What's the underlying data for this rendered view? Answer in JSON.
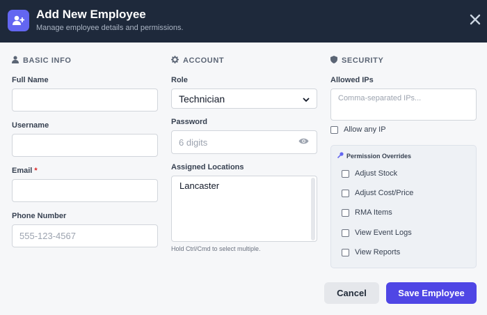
{
  "header": {
    "title": "Add New Employee",
    "subtitle": "Manage employee details and permissions."
  },
  "basic_info": {
    "section_title": "BASIC INFO",
    "full_name_label": "Full Name",
    "full_name_value": "",
    "username_label": "Username",
    "username_value": "",
    "email_label": "Email",
    "email_required": "*",
    "email_value": "",
    "phone_label": "Phone Number",
    "phone_placeholder": "555-123-4567",
    "phone_value": ""
  },
  "account": {
    "section_title": "ACCOUNT",
    "role_label": "Role",
    "role_value": "Technician",
    "password_label": "Password",
    "password_placeholder": "6 digits",
    "locations_label": "Assigned Locations",
    "locations": [
      "Lancaster"
    ],
    "locations_hint": "Hold Ctrl/Cmd to select multiple."
  },
  "security": {
    "section_title": "SECURITY",
    "allowed_ips_label": "Allowed IPs",
    "allowed_ips_placeholder": "Comma-separated IPs...",
    "allow_any_ip_label": "Allow any IP",
    "overrides_title": "Permission Overrides",
    "overrides": [
      {
        "label": "Adjust Stock",
        "checked": false
      },
      {
        "label": "Adjust Cost/Price",
        "checked": false
      },
      {
        "label": "RMA Items",
        "checked": false
      },
      {
        "label": "View Event Logs",
        "checked": false
      },
      {
        "label": "View Reports",
        "checked": false
      }
    ]
  },
  "footer": {
    "cancel_label": "Cancel",
    "save_label": "Save Employee"
  },
  "colors": {
    "header_bg": "#1e293b",
    "accent": "#4f46e5",
    "icon_accent": "#6366f1"
  },
  "icons": {
    "header": "user-plus-icon",
    "close": "close-icon",
    "basic_info": "user-icon",
    "account": "gear-icon",
    "security": "shield-icon",
    "password_toggle": "eye-icon",
    "overrides": "key-icon"
  }
}
